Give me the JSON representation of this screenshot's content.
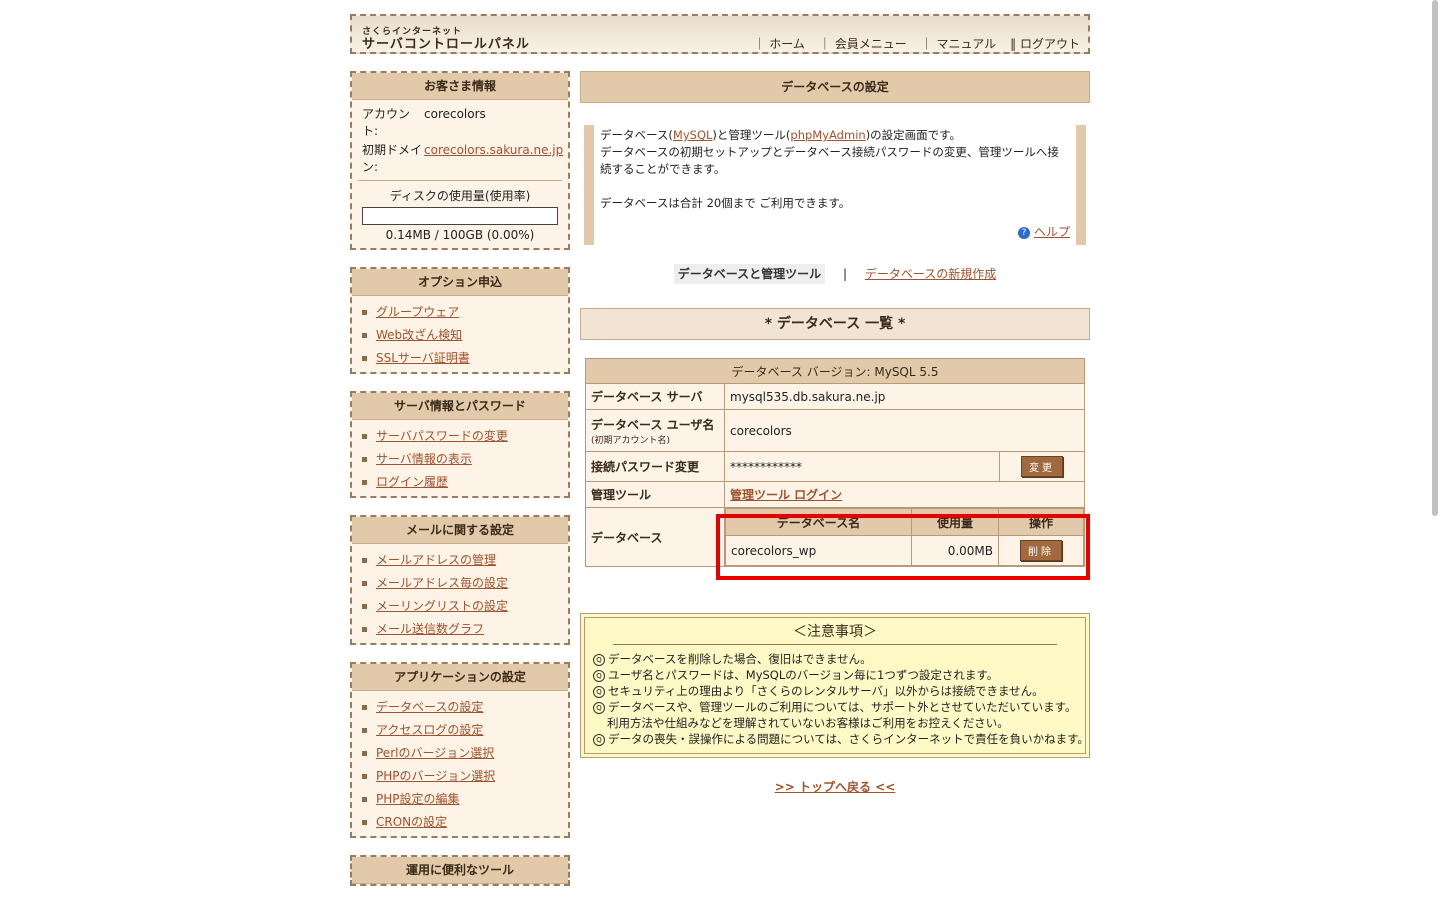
{
  "header": {
    "brand_small": "さくらインターネット",
    "brand_big": "サーバコントロールパネル",
    "nav": [
      "｜ ホーム",
      "｜ 会員メニュー",
      "｜ マニュアル",
      "‖ ログアウト"
    ]
  },
  "account": {
    "title": "お客さま情報",
    "account_label": "アカウント:",
    "account_value": "corecolors",
    "domain_label": "初期ドメイン:",
    "domain_value": "corecolors.sakura.ne.jp",
    "disk_label": "ディスクの使用量(使用率)",
    "disk_value": "0.14MB / 100GB (0.00%)",
    "disk_usage_percent": 0
  },
  "sidebar": [
    {
      "title": "オプション申込",
      "items": [
        "グループウェア",
        "Web改ざん検知",
        "SSLサーバ証明書"
      ]
    },
    {
      "title": "サーバ情報とパスワード",
      "items": [
        "サーバパスワードの変更",
        "サーバ情報の表示",
        "ログイン履歴"
      ]
    },
    {
      "title": "メールに関する設定",
      "items": [
        "メールアドレスの管理",
        "メールアドレス毎の設定",
        "メーリングリストの設定",
        "メール送信数グラフ"
      ]
    },
    {
      "title": "アプリケーションの設定",
      "items": [
        "データベースの設定",
        "アクセスログの設定",
        "Perlのバージョン選択",
        "PHPのバージョン選択",
        "PHP設定の編集",
        "CRONの設定"
      ]
    },
    {
      "title": "運用に便利なツール",
      "items": []
    }
  ],
  "main": {
    "title": "データベースの設定",
    "desc_line1_a": "データベース(",
    "desc_link_mysql": "MySQL",
    "desc_line1_b": ")と管理ツール(",
    "desc_link_pma": "phpMyAdmin",
    "desc_line1_c": ")の設定画面です。",
    "desc_line2": "データベースの初期セットアップとデータベース接続パスワードの変更、管理ツールへ接続することができます。",
    "desc_line3": "データベースは合計 20個まで ご利用できます。",
    "help": "ヘルプ",
    "tab_active": "データベースと管理ツール",
    "tab_sep": "|",
    "tab_new": "データベースの新規作成",
    "list_title": "* データベース 一覧 *"
  },
  "dbtable": {
    "version": "データベース バージョン: MySQL 5.5",
    "server_label": "データベース サーバ",
    "server_value": "mysql535.db.sakura.ne.jp",
    "user_label": "データベース ユーザ名",
    "user_sub": "(初期アカウント名)",
    "user_value": "corecolors",
    "pw_label": "接続パスワード変更",
    "pw_value": "************",
    "pw_button": "変更",
    "tool_label": "管理ツール",
    "tool_link": "管理ツール ログイン",
    "db_label": "データベース",
    "col_name": "データベース名",
    "col_usage": "使用量",
    "col_op": "操作",
    "db_name": "corecolors_wp",
    "db_usage": "0.00MB",
    "delete_button": "削除"
  },
  "notice": {
    "title": "＜注意事項＞",
    "items": [
      "データベースを削除した場合、復旧はできません。",
      "ユーザ名とパスワードは、MySQLのバージョン毎に1つずつ設定されます。",
      "セキュリティ上の理由より「さくらのレンタルサーバ」以外からは接続できません。",
      "データベースや、管理ツールのご利用については、サポート外とさせていただいています。",
      "データの喪失・誤操作による問題については、さくらインターネットで責任を負いかねます。"
    ],
    "sub_item": "利用方法や仕組みなどを理解されていないお客様はご利用をお控えください。"
  },
  "back_to_top": ">> トップへ戻る <<"
}
